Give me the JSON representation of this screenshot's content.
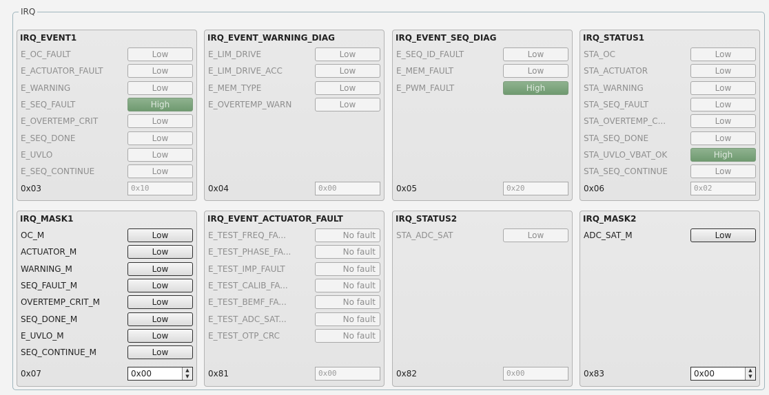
{
  "group_title": "IRQ",
  "panels": [
    {
      "title": "IRQ_EVENT1",
      "rows": [
        {
          "label": "E_OC_FAULT",
          "value": "Low",
          "state": "dis"
        },
        {
          "label": "E_ACTUATOR_FAULT",
          "value": "Low",
          "state": "dis"
        },
        {
          "label": "E_WARNING",
          "value": "Low",
          "state": "dis"
        },
        {
          "label": "E_SEQ_FAULT",
          "value": "High",
          "state": "high"
        },
        {
          "label": "E_OVERTEMP_CRIT",
          "value": "Low",
          "state": "dis"
        },
        {
          "label": "E_SEQ_DONE",
          "value": "Low",
          "state": "dis"
        },
        {
          "label": "E_UVLO",
          "value": "Low",
          "state": "dis"
        },
        {
          "label": "E_SEQ_CONTINUE",
          "value": "Low",
          "state": "dis"
        }
      ],
      "address": "0x03",
      "hex_value": "0x10",
      "hex_editable": false
    },
    {
      "title": "IRQ_EVENT_WARNING_DIAG",
      "rows": [
        {
          "label": "E_LIM_DRIVE",
          "value": "Low",
          "state": "dis"
        },
        {
          "label": "E_LIM_DRIVE_ACC",
          "value": "Low",
          "state": "dis"
        },
        {
          "label": "E_MEM_TYPE",
          "value": "Low",
          "state": "dis"
        },
        {
          "label": "E_OVERTEMP_WARN",
          "value": "Low",
          "state": "dis"
        }
      ],
      "address": "0x04",
      "hex_value": "0x00",
      "hex_editable": false
    },
    {
      "title": "IRQ_EVENT_SEQ_DIAG",
      "rows": [
        {
          "label": "E_SEQ_ID_FAULT",
          "value": "Low",
          "state": "dis"
        },
        {
          "label": "E_MEM_FAULT",
          "value": "Low",
          "state": "dis"
        },
        {
          "label": "E_PWM_FAULT",
          "value": "High",
          "state": "high"
        }
      ],
      "address": "0x05",
      "hex_value": "0x20",
      "hex_editable": false
    },
    {
      "title": "IRQ_STATUS1",
      "rows": [
        {
          "label": "STA_OC",
          "value": "Low",
          "state": "dis"
        },
        {
          "label": "STA_ACTUATOR",
          "value": "Low",
          "state": "dis"
        },
        {
          "label": "STA_WARNING",
          "value": "Low",
          "state": "dis"
        },
        {
          "label": "STA_SEQ_FAULT",
          "value": "Low",
          "state": "dis"
        },
        {
          "label": "STA_OVERTEMP_C...",
          "value": "Low",
          "state": "dis"
        },
        {
          "label": "STA_SEQ_DONE",
          "value": "Low",
          "state": "dis"
        },
        {
          "label": "STA_UVLO_VBAT_OK",
          "value": "High",
          "state": "high"
        },
        {
          "label": "STA_SEQ_CONTINUE",
          "value": "Low",
          "state": "dis"
        }
      ],
      "address": "0x06",
      "hex_value": "0x02",
      "hex_editable": false
    },
    {
      "title": "IRQ_MASK1",
      "rows": [
        {
          "label": "OC_M",
          "value": "Low",
          "state": "en"
        },
        {
          "label": "ACTUATOR_M",
          "value": "Low",
          "state": "en"
        },
        {
          "label": "WARNING_M",
          "value": "Low",
          "state": "en"
        },
        {
          "label": "SEQ_FAULT_M",
          "value": "Low",
          "state": "en"
        },
        {
          "label": "OVERTEMP_CRIT_M",
          "value": "Low",
          "state": "en"
        },
        {
          "label": "SEQ_DONE_M",
          "value": "Low",
          "state": "en"
        },
        {
          "label": "E_UVLO_M",
          "value": "Low",
          "state": "en"
        },
        {
          "label": "SEQ_CONTINUE_M",
          "value": "Low",
          "state": "en"
        }
      ],
      "address": "0x07",
      "hex_value": "0x00",
      "hex_editable": true
    },
    {
      "title": "IRQ_EVENT_ACTUATOR_FAULT",
      "rows": [
        {
          "label": "E_TEST_FREQ_FA...",
          "value": "No fault",
          "state": "dis-right"
        },
        {
          "label": "E_TEST_PHASE_FA...",
          "value": "No fault",
          "state": "dis-right"
        },
        {
          "label": "E_TEST_IMP_FAULT",
          "value": "No fault",
          "state": "dis-right"
        },
        {
          "label": "E_TEST_CALIB_FA...",
          "value": "No fault",
          "state": "dis-right"
        },
        {
          "label": "E_TEST_BEMF_FA...",
          "value": "No fault",
          "state": "dis-right"
        },
        {
          "label": "E_TEST_ADC_SAT...",
          "value": "No fault",
          "state": "dis-right"
        },
        {
          "label": "E_TEST_OTP_CRC",
          "value": "No fault",
          "state": "dis-right"
        }
      ],
      "address": "0x81",
      "hex_value": "0x00",
      "hex_editable": false
    },
    {
      "title": "IRQ_STATUS2",
      "rows": [
        {
          "label": "STA_ADC_SAT",
          "value": "Low",
          "state": "dis"
        }
      ],
      "address": "0x82",
      "hex_value": "0x00",
      "hex_editable": false
    },
    {
      "title": "IRQ_MASK2",
      "rows": [
        {
          "label": "ADC_SAT_M",
          "value": "Low",
          "state": "en"
        }
      ],
      "address": "0x83",
      "hex_value": "0x00",
      "hex_editable": true
    }
  ]
}
